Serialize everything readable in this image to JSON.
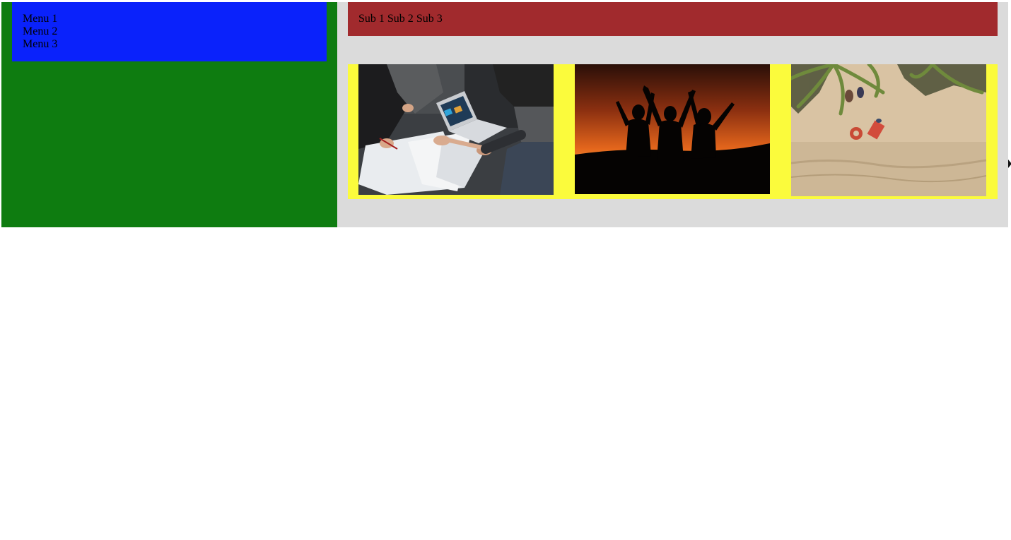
{
  "sidebar": {
    "menu": [
      {
        "label": "Menu 1"
      },
      {
        "label": "Menu 2"
      },
      {
        "label": "Menu 3"
      }
    ]
  },
  "subnav": {
    "items": [
      {
        "label": "Sub 1"
      },
      {
        "label": "Sub 2"
      },
      {
        "label": "Sub 3"
      }
    ]
  },
  "gallery": {
    "photos": [
      {
        "subject": "team-meeting-laptop-photo"
      },
      {
        "subject": "sunset-silhouettes-photo"
      },
      {
        "subject": "beach-palm-aerial-photo"
      }
    ]
  },
  "colors": {
    "sidebar_bg": "#0e7c10",
    "menu_bg": "#0a22fb",
    "content_bg": "#dbdbdb",
    "subnav_bg": "#a12a2d",
    "gallery_bg": "#fbfb3c",
    "page_bg": "#ffffff"
  }
}
